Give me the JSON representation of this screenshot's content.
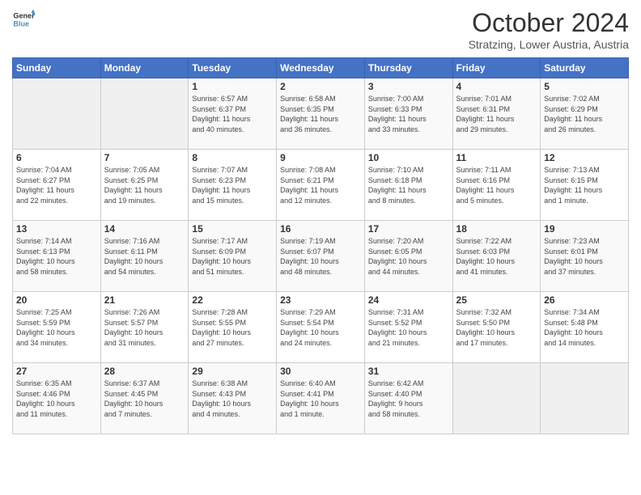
{
  "header": {
    "logo_line1": "General",
    "logo_line2": "Blue",
    "month": "October 2024",
    "location": "Stratzing, Lower Austria, Austria"
  },
  "days_of_week": [
    "Sunday",
    "Monday",
    "Tuesday",
    "Wednesday",
    "Thursday",
    "Friday",
    "Saturday"
  ],
  "weeks": [
    [
      {
        "day": "",
        "info": ""
      },
      {
        "day": "",
        "info": ""
      },
      {
        "day": "1",
        "info": "Sunrise: 6:57 AM\nSunset: 6:37 PM\nDaylight: 11 hours\nand 40 minutes."
      },
      {
        "day": "2",
        "info": "Sunrise: 6:58 AM\nSunset: 6:35 PM\nDaylight: 11 hours\nand 36 minutes."
      },
      {
        "day": "3",
        "info": "Sunrise: 7:00 AM\nSunset: 6:33 PM\nDaylight: 11 hours\nand 33 minutes."
      },
      {
        "day": "4",
        "info": "Sunrise: 7:01 AM\nSunset: 6:31 PM\nDaylight: 11 hours\nand 29 minutes."
      },
      {
        "day": "5",
        "info": "Sunrise: 7:02 AM\nSunset: 6:29 PM\nDaylight: 11 hours\nand 26 minutes."
      }
    ],
    [
      {
        "day": "6",
        "info": "Sunrise: 7:04 AM\nSunset: 6:27 PM\nDaylight: 11 hours\nand 22 minutes."
      },
      {
        "day": "7",
        "info": "Sunrise: 7:05 AM\nSunset: 6:25 PM\nDaylight: 11 hours\nand 19 minutes."
      },
      {
        "day": "8",
        "info": "Sunrise: 7:07 AM\nSunset: 6:23 PM\nDaylight: 11 hours\nand 15 minutes."
      },
      {
        "day": "9",
        "info": "Sunrise: 7:08 AM\nSunset: 6:21 PM\nDaylight: 11 hours\nand 12 minutes."
      },
      {
        "day": "10",
        "info": "Sunrise: 7:10 AM\nSunset: 6:18 PM\nDaylight: 11 hours\nand 8 minutes."
      },
      {
        "day": "11",
        "info": "Sunrise: 7:11 AM\nSunset: 6:16 PM\nDaylight: 11 hours\nand 5 minutes."
      },
      {
        "day": "12",
        "info": "Sunrise: 7:13 AM\nSunset: 6:15 PM\nDaylight: 11 hours\nand 1 minute."
      }
    ],
    [
      {
        "day": "13",
        "info": "Sunrise: 7:14 AM\nSunset: 6:13 PM\nDaylight: 10 hours\nand 58 minutes."
      },
      {
        "day": "14",
        "info": "Sunrise: 7:16 AM\nSunset: 6:11 PM\nDaylight: 10 hours\nand 54 minutes."
      },
      {
        "day": "15",
        "info": "Sunrise: 7:17 AM\nSunset: 6:09 PM\nDaylight: 10 hours\nand 51 minutes."
      },
      {
        "day": "16",
        "info": "Sunrise: 7:19 AM\nSunset: 6:07 PM\nDaylight: 10 hours\nand 48 minutes."
      },
      {
        "day": "17",
        "info": "Sunrise: 7:20 AM\nSunset: 6:05 PM\nDaylight: 10 hours\nand 44 minutes."
      },
      {
        "day": "18",
        "info": "Sunrise: 7:22 AM\nSunset: 6:03 PM\nDaylight: 10 hours\nand 41 minutes."
      },
      {
        "day": "19",
        "info": "Sunrise: 7:23 AM\nSunset: 6:01 PM\nDaylight: 10 hours\nand 37 minutes."
      }
    ],
    [
      {
        "day": "20",
        "info": "Sunrise: 7:25 AM\nSunset: 5:59 PM\nDaylight: 10 hours\nand 34 minutes."
      },
      {
        "day": "21",
        "info": "Sunrise: 7:26 AM\nSunset: 5:57 PM\nDaylight: 10 hours\nand 31 minutes."
      },
      {
        "day": "22",
        "info": "Sunrise: 7:28 AM\nSunset: 5:55 PM\nDaylight: 10 hours\nand 27 minutes."
      },
      {
        "day": "23",
        "info": "Sunrise: 7:29 AM\nSunset: 5:54 PM\nDaylight: 10 hours\nand 24 minutes."
      },
      {
        "day": "24",
        "info": "Sunrise: 7:31 AM\nSunset: 5:52 PM\nDaylight: 10 hours\nand 21 minutes."
      },
      {
        "day": "25",
        "info": "Sunrise: 7:32 AM\nSunset: 5:50 PM\nDaylight: 10 hours\nand 17 minutes."
      },
      {
        "day": "26",
        "info": "Sunrise: 7:34 AM\nSunset: 5:48 PM\nDaylight: 10 hours\nand 14 minutes."
      }
    ],
    [
      {
        "day": "27",
        "info": "Sunrise: 6:35 AM\nSunset: 4:46 PM\nDaylight: 10 hours\nand 11 minutes."
      },
      {
        "day": "28",
        "info": "Sunrise: 6:37 AM\nSunset: 4:45 PM\nDaylight: 10 hours\nand 7 minutes."
      },
      {
        "day": "29",
        "info": "Sunrise: 6:38 AM\nSunset: 4:43 PM\nDaylight: 10 hours\nand 4 minutes."
      },
      {
        "day": "30",
        "info": "Sunrise: 6:40 AM\nSunset: 4:41 PM\nDaylight: 10 hours\nand 1 minute."
      },
      {
        "day": "31",
        "info": "Sunrise: 6:42 AM\nSunset: 4:40 PM\nDaylight: 9 hours\nand 58 minutes."
      },
      {
        "day": "",
        "info": ""
      },
      {
        "day": "",
        "info": ""
      }
    ]
  ]
}
